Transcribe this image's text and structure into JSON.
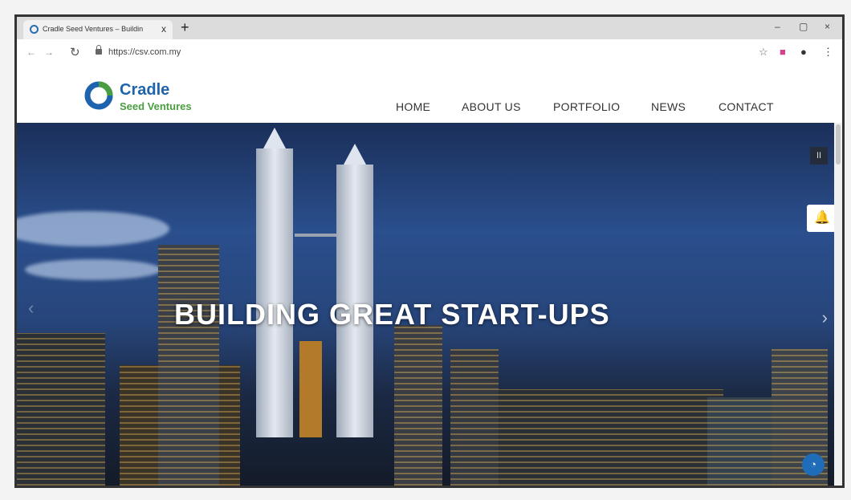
{
  "browser": {
    "tab_title": "Cradle Seed Ventures – Buildin",
    "tab_close": "x",
    "new_tab": "+",
    "url": "https://csv.com.my",
    "window_controls": [
      "–",
      "▢",
      "×"
    ]
  },
  "site": {
    "logo_line1": "Cradle",
    "logo_line2": "Seed Ventures",
    "nav": [
      "HOME",
      "ABOUT US",
      "PORTFOLIO",
      "NEWS",
      "CONTACT"
    ]
  },
  "hero": {
    "headline": "BUILDING GREAT START-UPS",
    "pause_glyph": "II"
  },
  "colors": {
    "brand_blue": "#1e63ad",
    "brand_green": "#4b9e3f",
    "bell_red": "#c0392b"
  },
  "icons": [
    "back-icon",
    "forward-icon",
    "reload-icon",
    "lock-icon",
    "star-icon",
    "extension-icon",
    "account-icon",
    "menu-icon",
    "bell-icon",
    "pause-icon",
    "chevron-right-icon"
  ]
}
